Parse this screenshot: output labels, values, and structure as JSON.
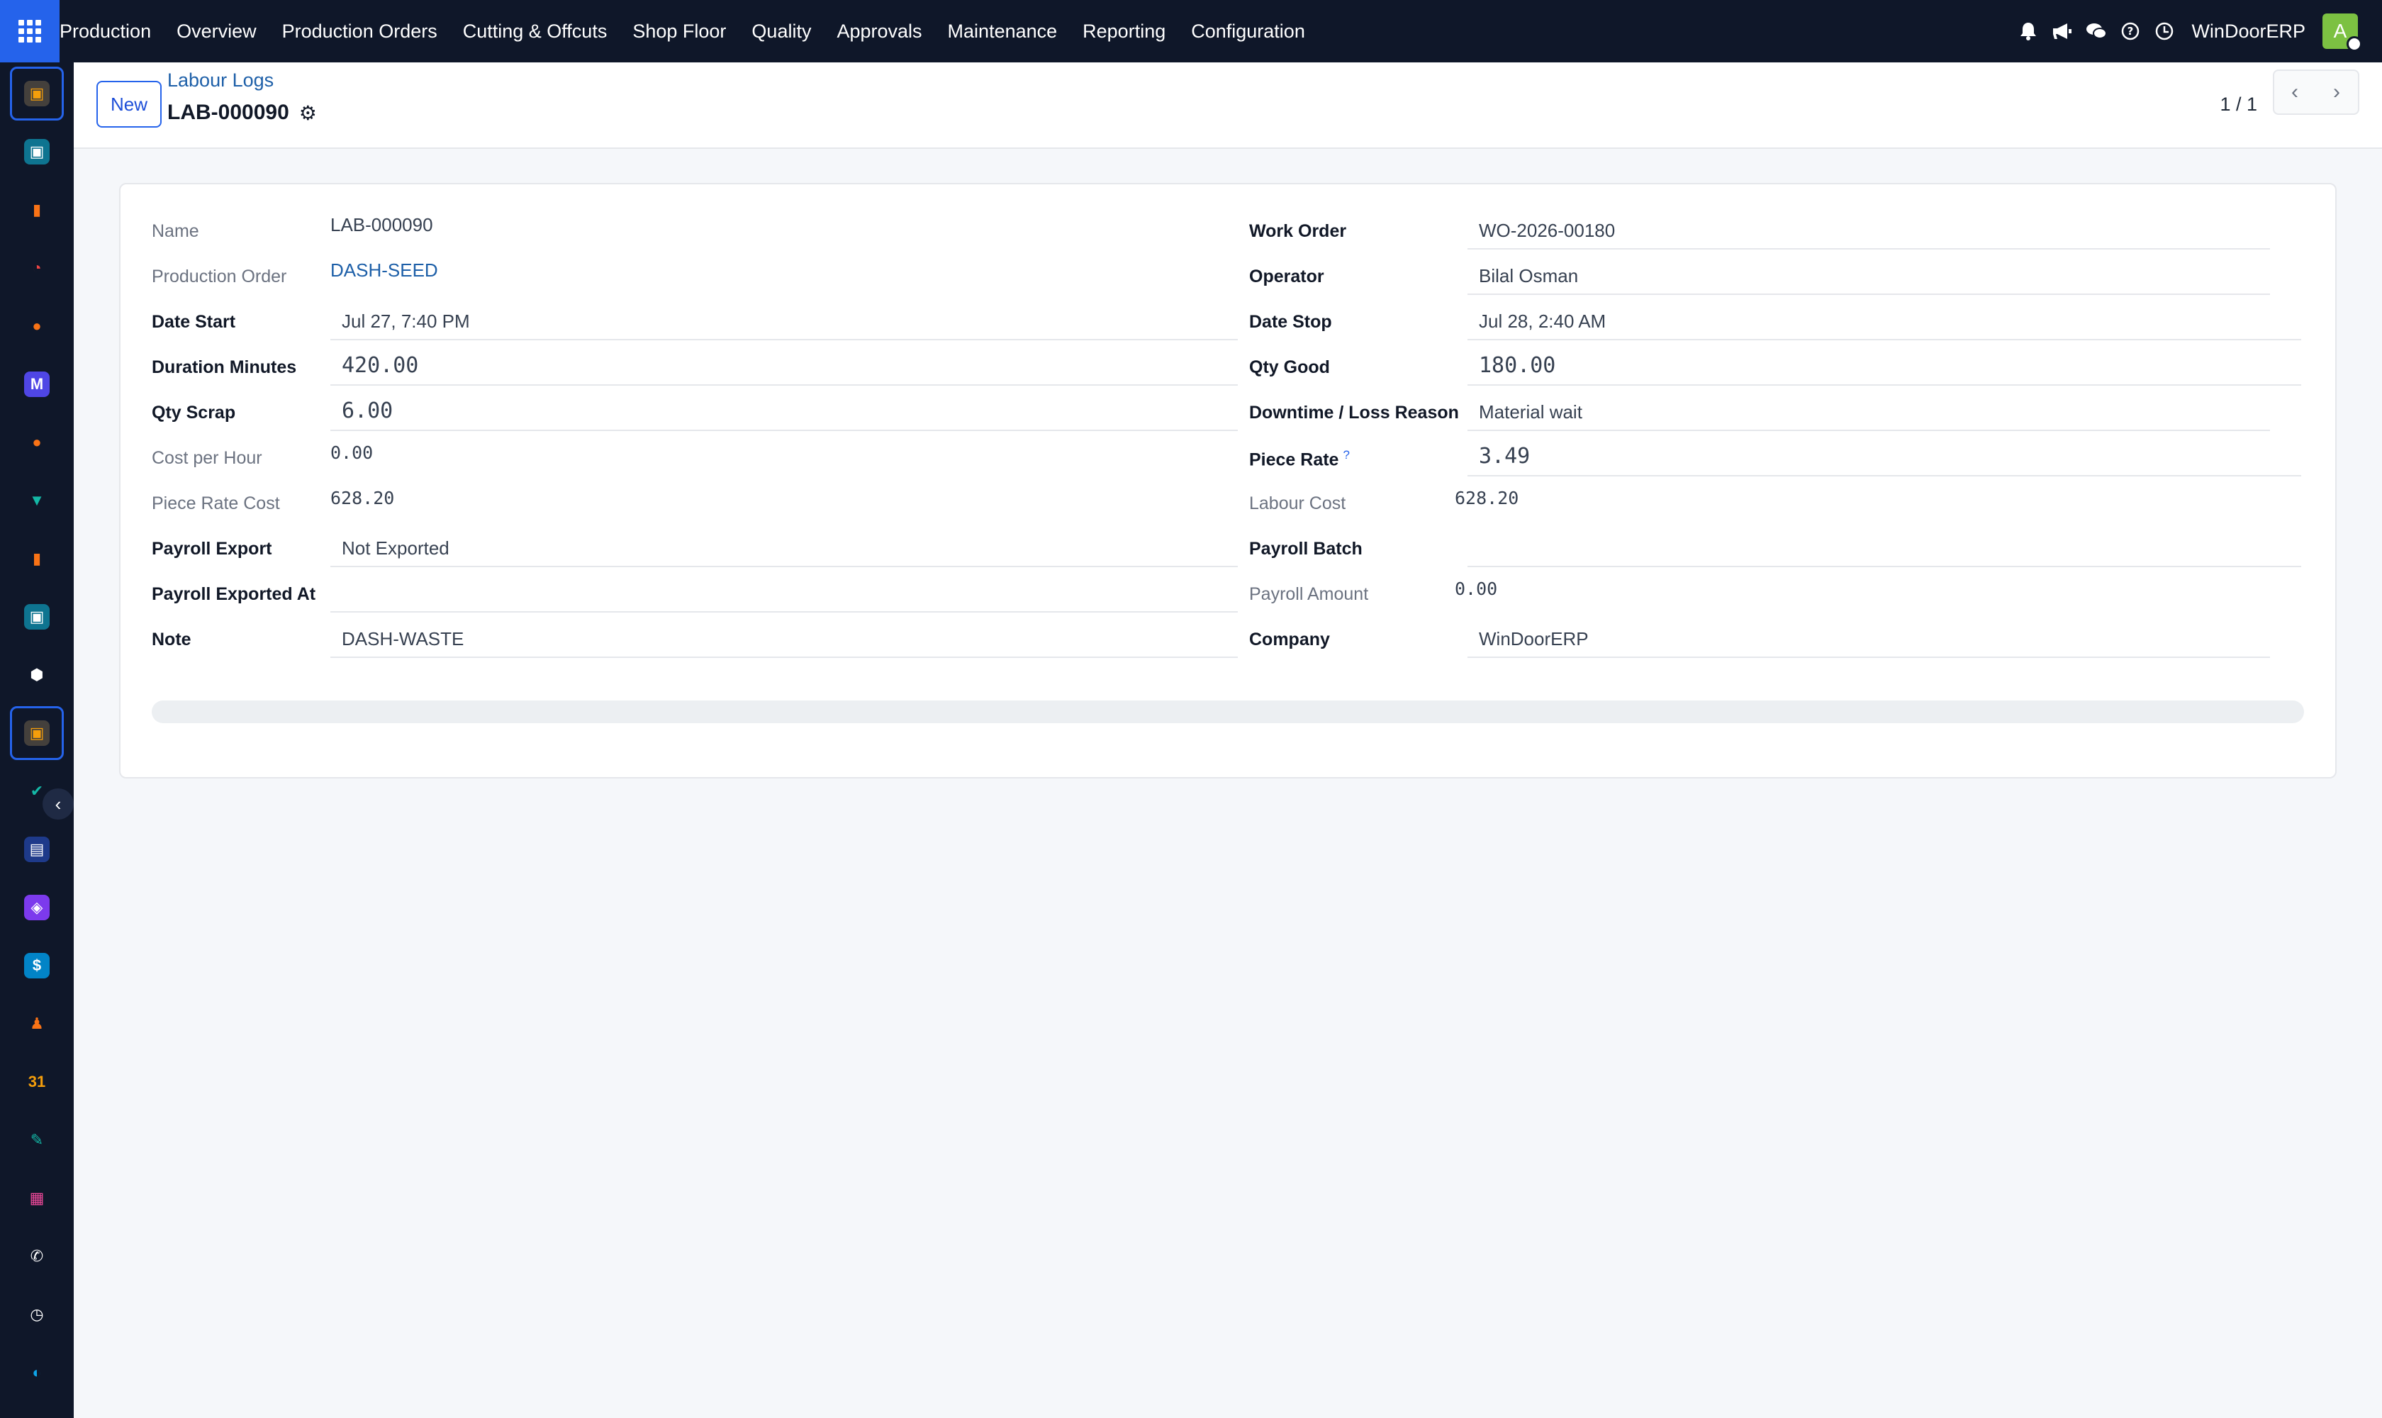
{
  "topbar": {
    "brand": "Production",
    "menu": [
      "Overview",
      "Production Orders",
      "Cutting & Offcuts",
      "Shop Floor",
      "Quality",
      "Approvals",
      "Maintenance",
      "Reporting",
      "Configuration"
    ],
    "company": "WinDoorERP",
    "avatar_initial": "A"
  },
  "icons": {
    "apps": "apps-grid-icon",
    "bell": "bell-icon",
    "megaphone": "megaphone-icon",
    "chat": "chat-icon",
    "help": "help-icon",
    "clock": "clock-icon",
    "gear": "gear-icon"
  },
  "dock": {
    "items": [
      {
        "name": "production-app",
        "glyph": "▣",
        "color": "#f59e0b",
        "bg": "#44403c"
      },
      {
        "name": "contacts-app",
        "glyph": "▣",
        "color": "#ffffff",
        "bg": "#0e7490"
      },
      {
        "name": "reporting-app",
        "glyph": "▮",
        "color": "#f97316",
        "bg": "transparent"
      },
      {
        "name": "dashboard-app",
        "glyph": "◔",
        "color": "#ef4444",
        "bg": "transparent"
      },
      {
        "name": "discuss-app",
        "glyph": "●",
        "color": "#f97316",
        "bg": "transparent"
      },
      {
        "name": "mail-app",
        "glyph": "M",
        "color": "#ffffff",
        "bg": "#4f46e5"
      },
      {
        "name": "chat-app",
        "glyph": "●",
        "color": "#f97316",
        "bg": "transparent"
      },
      {
        "name": "sales-app",
        "glyph": "▼",
        "color": "#14b8a6",
        "bg": "transparent"
      },
      {
        "name": "analytics-app",
        "glyph": "▮",
        "color": "#f97316",
        "bg": "transparent"
      },
      {
        "name": "employees-app",
        "glyph": "▣",
        "color": "#ffffff",
        "bg": "#0e7490"
      },
      {
        "name": "inventory-app",
        "glyph": "⬢",
        "color": "#ffffff",
        "bg": "transparent"
      },
      {
        "name": "manufacturing-app",
        "glyph": "▣",
        "color": "#f59e0b",
        "bg": "#44403c"
      },
      {
        "name": "tasks-app",
        "glyph": "✔",
        "color": "#14b8a6",
        "bg": "transparent"
      },
      {
        "name": "knowledge-app",
        "glyph": "▤",
        "color": "#ffffff",
        "bg": "#1e3a8a"
      },
      {
        "name": "products-app",
        "glyph": "◈",
        "color": "#ffffff",
        "bg": "#7c3aed"
      },
      {
        "name": "invoicing-app",
        "glyph": "$",
        "color": "#ffffff",
        "bg": "#0284c7"
      },
      {
        "name": "team-app",
        "glyph": "♟",
        "color": "#f97316",
        "bg": "transparent"
      },
      {
        "name": "calendar-app",
        "glyph": "31",
        "color": "#f59e0b",
        "bg": "transparent"
      },
      {
        "name": "sign-app",
        "glyph": "✎",
        "color": "#14b8a6",
        "bg": "transparent"
      },
      {
        "name": "board-app",
        "glyph": "▦",
        "color": "#ec4899",
        "bg": "transparent"
      },
      {
        "name": "whatsapp-app",
        "glyph": "✆",
        "color": "#ffffff",
        "bg": "transparent"
      },
      {
        "name": "timer-app",
        "glyph": "◷",
        "color": "#ffffff",
        "bg": "transparent"
      },
      {
        "name": "website-app",
        "glyph": "◐",
        "color": "#0ea5e9",
        "bg": "transparent"
      }
    ]
  },
  "control": {
    "new_label": "New",
    "breadcrumb": "Labour Logs",
    "record_title": "LAB-000090",
    "pager": "1 / 1"
  },
  "form": {
    "left": [
      {
        "label": "Name",
        "value": "LAB-000090",
        "kind": "readonly",
        "strong": false
      },
      {
        "label": "Production Order",
        "value": "DASH-SEED",
        "kind": "link",
        "strong": false
      },
      {
        "label": "Date Start",
        "value": "Jul 27, 7:40 PM",
        "kind": "input",
        "strong": true
      },
      {
        "label": "Duration Minutes",
        "value": "420.00",
        "kind": "input-mono",
        "strong": true
      },
      {
        "label": "Qty Scrap",
        "value": "6.00",
        "kind": "input-mono",
        "strong": true
      },
      {
        "label": "Cost per Hour",
        "value": "0.00",
        "kind": "readonly-mono",
        "strong": false
      },
      {
        "label": "Piece Rate Cost",
        "value": "628.20",
        "kind": "readonly-mono",
        "strong": false
      },
      {
        "label": "Payroll Export",
        "value": "Not Exported",
        "kind": "input",
        "strong": true
      },
      {
        "label": "Payroll Exported At",
        "value": "",
        "kind": "input",
        "strong": true
      },
      {
        "label": "Note",
        "value": "DASH-WASTE",
        "kind": "input",
        "strong": true
      }
    ],
    "right": [
      {
        "label": "Work Order",
        "value": "WO-2026-00180",
        "kind": "input-short",
        "strong": true
      },
      {
        "label": "Operator",
        "value": "Bilal Osman",
        "kind": "input-short",
        "strong": true
      },
      {
        "label": "Date Stop",
        "value": "Jul 28, 2:40 AM",
        "kind": "input",
        "strong": true
      },
      {
        "label": "Qty Good",
        "value": "180.00",
        "kind": "input-mono",
        "strong": true
      },
      {
        "label": "Downtime / Loss Reason",
        "value": "Material wait",
        "kind": "input-short",
        "strong": true
      },
      {
        "label": "Piece Rate",
        "value": "3.49",
        "kind": "input-mono",
        "strong": true,
        "help": "?"
      },
      {
        "label": "Labour Cost",
        "value": "628.20",
        "kind": "readonly-mono",
        "strong": false
      },
      {
        "label": "Payroll Batch",
        "value": "",
        "kind": "input",
        "strong": true
      },
      {
        "label": "Payroll Amount",
        "value": "0.00",
        "kind": "readonly-mono",
        "strong": false
      },
      {
        "label": "Company",
        "value": "WinDoorERP",
        "kind": "input-short",
        "strong": true
      }
    ]
  },
  "colors": {
    "navbar": "#0f1729",
    "accent": "#2563eb",
    "link": "#1d5fa8",
    "background": "#f5f7fa",
    "avatar": "#7cc142"
  }
}
